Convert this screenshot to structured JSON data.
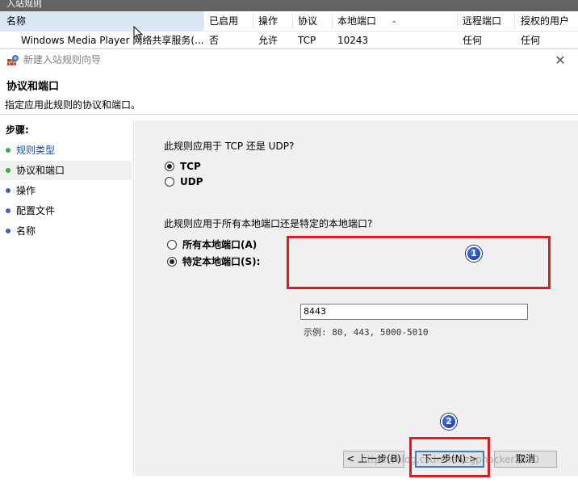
{
  "background_window": {
    "title": "入站规则",
    "columns": [
      "名称",
      "已启用",
      "操作",
      "协议",
      "本地端口",
      "远程端口",
      "授权的用户"
    ],
    "row": {
      "name": "Windows Media Player 网络共享服务(...",
      "enabled": "否",
      "action": "允许",
      "protocol": "TCP",
      "local_port": "10243",
      "remote_port": "任何",
      "authorized_users": "任何"
    }
  },
  "dialog": {
    "title": "新建入站规则向导",
    "page_title": "协议和端口",
    "page_subtitle": "指定应用此规则的协议和端口。",
    "steps_title": "步骤:",
    "steps": [
      "规则类型",
      "协议和端口",
      "操作",
      "配置文件",
      "名称"
    ],
    "protocol_question": "此规则应用于 TCP 还是 UDP?",
    "protocol_options": [
      "TCP",
      "UDP"
    ],
    "protocol_selected": "TCP",
    "port_question": "此规则应用于所有本地端口还是特定的本地端口?",
    "port_options": [
      "所有本地端口(A)",
      "特定本地端口(S):"
    ],
    "port_selected": "特定本地端口(S):",
    "port_value": "8443",
    "port_example": "示例: 80, 443, 5000-5010",
    "buttons": {
      "back": "< 上一步(B)",
      "next": "下一步(N) >",
      "cancel": "取消"
    }
  },
  "annotations": {
    "badge_1": "1",
    "badge_2": "2",
    "highlight_color": "#e11b1b"
  },
  "watermark": "https://blog.csdn.net/zgphacker2010"
}
